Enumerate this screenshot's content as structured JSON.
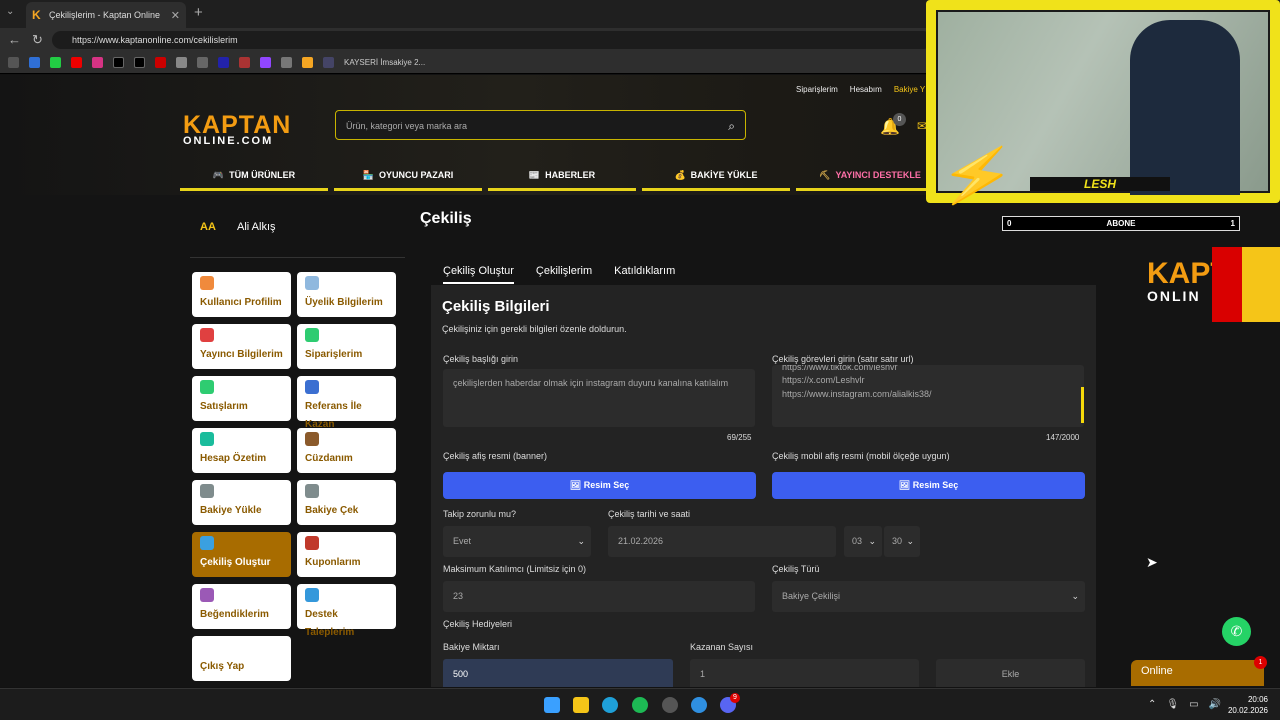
{
  "browser": {
    "tab_title": "Çekilişlerim - Kaptan Online",
    "tab_favicon": "K",
    "url": "https://www.kaptanonline.com/cekilislerim",
    "bookmark_label": "KAYSERİ İmsakiye 2...",
    "newtab_icon": "+",
    "close_icon": "✕"
  },
  "header": {
    "top_links": [
      "Siparişlerim",
      "Hesabım",
      "Bakiye Y"
    ],
    "logo_line1": "KAPTAN",
    "logo_line2": "ONLINE.COM",
    "search_placeholder": "Ürün, kategori veya marka ara",
    "bell_count": "0"
  },
  "main_nav": [
    {
      "label": "TÜM ÜRÜNLER",
      "icon": "gamepad-icon"
    },
    {
      "label": "OYUNCU PAZARI",
      "icon": "store-icon"
    },
    {
      "label": "HABERLER",
      "icon": "news-icon"
    },
    {
      "label": "BAKİYE YÜKLE",
      "icon": "coins-icon"
    },
    {
      "label": "YAYINCI DESTEKLE",
      "icon": "streamer-icon"
    }
  ],
  "user": {
    "initials": "AA",
    "name": "Ali Alkış"
  },
  "sidebar": [
    {
      "label": "Kullanıcı Profilim",
      "color": "#f08a3c"
    },
    {
      "label": "Üyelik Bilgilerim",
      "color": "#8fb8de"
    },
    {
      "label": "Yayıncı Bilgilerim",
      "color": "#e04040"
    },
    {
      "label": "Siparişlerim",
      "color": "#2ecc71"
    },
    {
      "label": "Satışlarım",
      "color": "#2ecc71"
    },
    {
      "label": "Referans İle Kazan",
      "color": "#3b6fd1"
    },
    {
      "label": "Hesap Özetim",
      "color": "#1abc9c"
    },
    {
      "label": "Cüzdanım",
      "color": "#8b5a2b"
    },
    {
      "label": "Bakiye Yükle",
      "color": "#7f8c8d"
    },
    {
      "label": "Bakiye Çek",
      "color": "#7f8c8d"
    },
    {
      "label": "Çekiliş Oluştur",
      "color": "#3aa0e0"
    },
    {
      "label": "Kuponlarım",
      "color": "#c0392b"
    },
    {
      "label": "Beğendiklerim",
      "color": "#9b59b6"
    },
    {
      "label": "Destek Taleplerim",
      "color": "#3498db"
    },
    {
      "label": "Çıkış Yap",
      "color": "#ffffff"
    }
  ],
  "content": {
    "page_title": "Çekiliş",
    "tabs": [
      "Çekiliş Oluştur",
      "Çekilişlerim",
      "Katıldıklarım"
    ],
    "panel_title": "Çekiliş Bilgileri",
    "panel_subtitle": "Çekilişiniz için gerekli bilgileri özenle doldurun.",
    "title_label": "Çekiliş başlığı girin",
    "title_value": "çekilişlerden haberdar olmak için instagram duyuru kanalına katılalım",
    "title_count": "69/255",
    "tasks_label": "Çekiliş görevleri girin (satır satır url)",
    "tasks_lines": [
      "https://www.tiktok.com/leshvr",
      "https://x.com/Leshvlr",
      "https://www.instagram.com/alialkis38/"
    ],
    "tasks_count": "147/2000",
    "banner_label": "Çekiliş afiş resmi (banner)",
    "mobile_label": "Çekiliş mobil afiş resmi (mobil ölçeğe uygun)",
    "pick_image": "Resim Seç",
    "follow_label": "Takip zorunlu mu?",
    "follow_value": "Evet",
    "date_label": "Çekiliş tarihi ve saati",
    "date_value": "21.02.2026",
    "hour_value": "03",
    "minute_value": "30",
    "max_label": "Maksimum Katılımcı (Limitsiz için 0)",
    "max_value": "23",
    "type_label": "Çekiliş Türü",
    "type_value": "Bakiye Çekilişi",
    "prizes_label": "Çekiliş Hediyeleri",
    "amount_label": "Bakiye Miktarı",
    "amount_value": "500",
    "winners_label": "Kazanan Sayısı",
    "winners_value": "1",
    "add_label": "Ekle"
  },
  "overlay": {
    "name": "LESH",
    "abone_left": "0",
    "abone_center": "ABONE",
    "abone_right": "1",
    "side_logo1": "KAPT",
    "side_logo2": "ONLIN"
  },
  "widgets": {
    "online_label": "Online",
    "online_badge": "1"
  },
  "taskbar": {
    "time": "20:06",
    "date": "20.02.2026",
    "discord_badge": "9"
  }
}
